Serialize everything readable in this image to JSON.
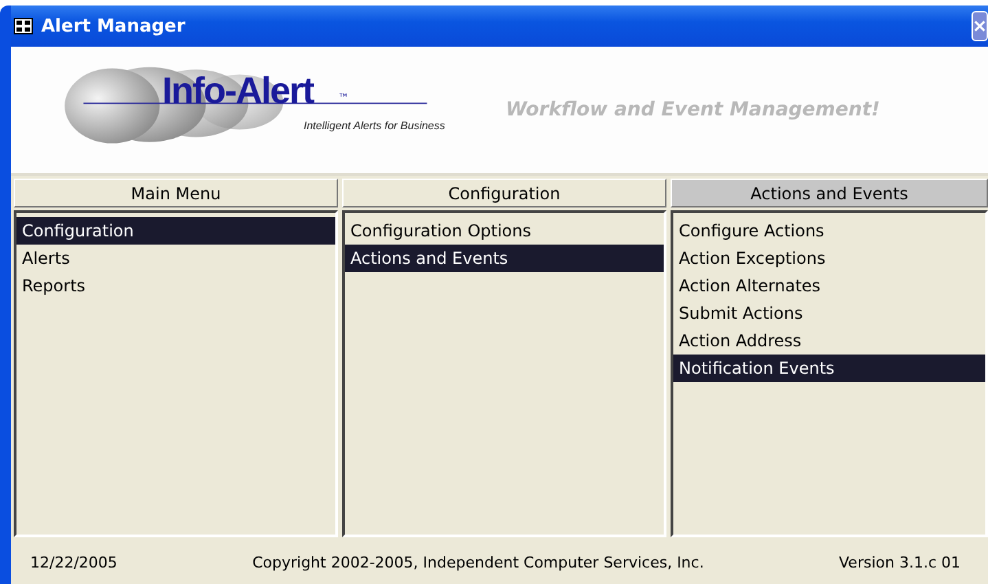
{
  "window": {
    "title": "Alert Manager"
  },
  "banner": {
    "logo_name": "Info-Alert",
    "logo_mark": "™",
    "logo_tagline": "Intelligent Alerts for Business",
    "slogan": "Workflow and Event Management!"
  },
  "columns": [
    {
      "header": "Main Menu",
      "selected": false,
      "items": [
        {
          "label": "Configuration",
          "selected": true
        },
        {
          "label": "Alerts",
          "selected": false
        },
        {
          "label": "Reports",
          "selected": false
        }
      ]
    },
    {
      "header": "Configuration",
      "selected": false,
      "items": [
        {
          "label": "Configuration Options",
          "selected": false
        },
        {
          "label": "Actions and Events",
          "selected": true
        }
      ]
    },
    {
      "header": "Actions and Events",
      "selected": true,
      "items": [
        {
          "label": "Configure Actions",
          "selected": false
        },
        {
          "label": "Action Exceptions",
          "selected": false
        },
        {
          "label": "Action Alternates",
          "selected": false
        },
        {
          "label": "Submit Actions",
          "selected": false
        },
        {
          "label": "Action Address",
          "selected": false
        },
        {
          "label": "Notification Events",
          "selected": true
        }
      ]
    }
  ],
  "status_bar": {
    "date": "12/22/2005",
    "copyright": "Copyright 2002-2005, Independent Computer Services, Inc.",
    "version": "Version 3.1.c 01"
  }
}
